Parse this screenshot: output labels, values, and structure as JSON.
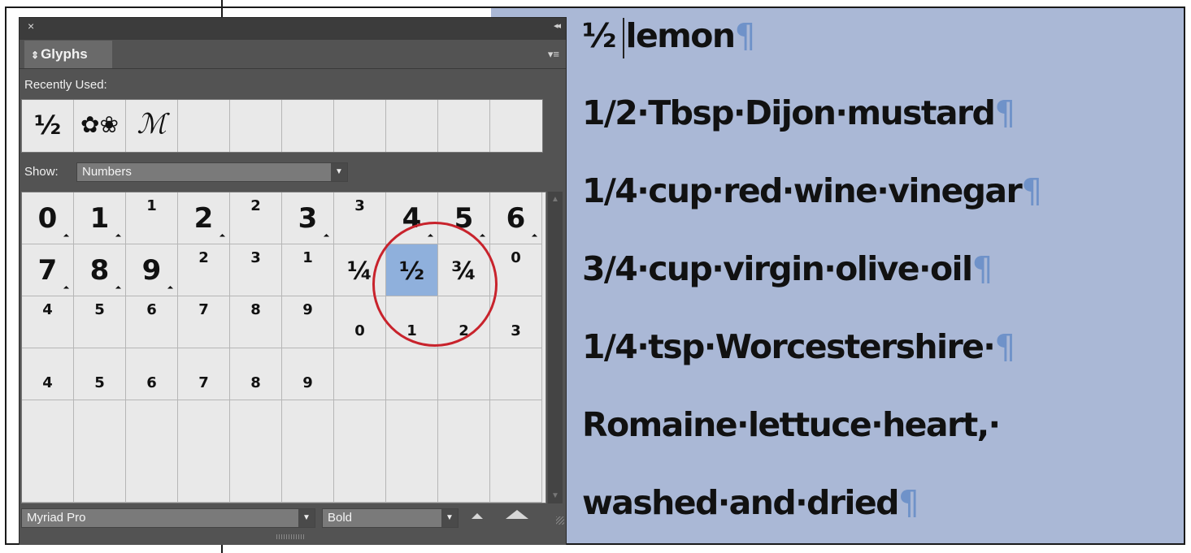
{
  "document": {
    "lines": [
      {
        "text": "½ lemon",
        "pilcrow": "¶"
      },
      {
        "text": "1/2·Tbsp·Dijon·mustard",
        "pilcrow": "¶"
      },
      {
        "text": "1/4·cup·red·wine·vinegar",
        "pilcrow": "¶"
      },
      {
        "text": "3/4·cup·virgin·olive·oil",
        "pilcrow": "¶"
      },
      {
        "text": "1/4·tsp·Worcestershire·",
        "pilcrow": "¶"
      },
      {
        "text": "Romaine·lettuce·heart,·",
        "pilcrow": ""
      },
      {
        "text": "washed·and·dried",
        "pilcrow": "¶"
      }
    ],
    "selection_color": "#aab8d6"
  },
  "panel": {
    "close_icon": "×",
    "collapse_icon": "◂◂",
    "tab_label": "Glyphs",
    "tab_icon": "⇕",
    "menu_icon": "▾≡",
    "recent_label": "Recently Used:",
    "recent_glyphs": [
      "½",
      "✿❀",
      "ℳ",
      "",
      "",
      "",
      "",
      "",
      "",
      ""
    ],
    "show_label": "Show:",
    "show_value": "Numbers",
    "grid": [
      [
        {
          "c": "0",
          "k": "big",
          "alt": true
        },
        {
          "c": "1",
          "k": "big",
          "alt": true
        },
        {
          "c": "1",
          "k": "sup"
        },
        {
          "c": "2",
          "k": "big",
          "alt": true
        },
        {
          "c": "2",
          "k": "sup"
        },
        {
          "c": "3",
          "k": "big",
          "alt": true
        },
        {
          "c": "3",
          "k": "sup"
        },
        {
          "c": "4",
          "k": "big",
          "alt": true
        },
        {
          "c": "5",
          "k": "big",
          "alt": true
        },
        {
          "c": "6",
          "k": "big",
          "alt": true
        }
      ],
      [
        {
          "c": "7",
          "k": "big",
          "alt": true
        },
        {
          "c": "8",
          "k": "big",
          "alt": true
        },
        {
          "c": "9",
          "k": "big",
          "alt": true
        },
        {
          "c": "2",
          "k": "sup"
        },
        {
          "c": "3",
          "k": "sup"
        },
        {
          "c": "1",
          "k": "sup"
        },
        {
          "c": "¼",
          "k": "frac"
        },
        {
          "c": "½",
          "k": "frac",
          "sel": true
        },
        {
          "c": "¾",
          "k": "frac"
        },
        {
          "c": "0",
          "k": "sup"
        }
      ],
      [
        {
          "c": "4",
          "k": "sup"
        },
        {
          "c": "5",
          "k": "sup"
        },
        {
          "c": "6",
          "k": "sup"
        },
        {
          "c": "7",
          "k": "sup"
        },
        {
          "c": "8",
          "k": "sup"
        },
        {
          "c": "9",
          "k": "sup"
        },
        {
          "c": "0",
          "k": "sub"
        },
        {
          "c": "1",
          "k": "sub"
        },
        {
          "c": "2",
          "k": "sub"
        },
        {
          "c": "3",
          "k": "sub"
        }
      ],
      [
        {
          "c": "4",
          "k": "sub"
        },
        {
          "c": "5",
          "k": "sub"
        },
        {
          "c": "6",
          "k": "sub"
        },
        {
          "c": "7",
          "k": "sub"
        },
        {
          "c": "8",
          "k": "sub"
        },
        {
          "c": "9",
          "k": "sub"
        },
        {
          "c": "",
          "k": "sub"
        },
        {
          "c": "",
          "k": "sub"
        },
        {
          "c": "",
          "k": "sub"
        },
        {
          "c": "",
          "k": "sub"
        }
      ],
      [
        {
          "c": "",
          "k": "sub"
        },
        {
          "c": "",
          "k": "sub"
        },
        {
          "c": "",
          "k": "sub"
        },
        {
          "c": "",
          "k": "sub"
        },
        {
          "c": "",
          "k": "sub"
        },
        {
          "c": "",
          "k": "sub"
        },
        {
          "c": "",
          "k": "sub"
        },
        {
          "c": "",
          "k": "sub"
        },
        {
          "c": "",
          "k": "sub"
        },
        {
          "c": "",
          "k": "sub"
        }
      ]
    ],
    "font_family": "Myriad Pro",
    "font_style": "Bold",
    "highlight_color": "#c8232c"
  }
}
